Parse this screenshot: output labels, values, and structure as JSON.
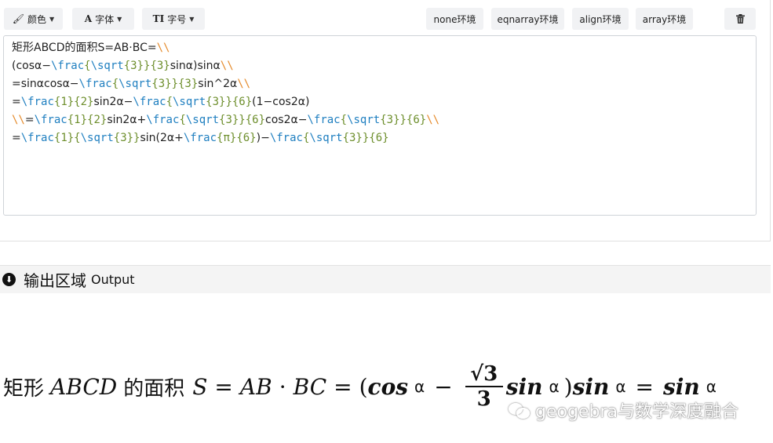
{
  "toolbar": {
    "color_label": "颜色",
    "font_label": "字体",
    "size_label": "字号",
    "env_buttons": [
      "none环境",
      "eqnarray环境",
      "align环境",
      "array环境"
    ],
    "trash_icon": "trash-icon"
  },
  "editor": {
    "lines": [
      [
        {
          "t": "txt",
          "v": "矩形ABCD的面积S=AB·BC="
        },
        {
          "t": "nl",
          "v": "\\\\"
        }
      ],
      [
        {
          "t": "txt",
          "v": "(cosα−"
        },
        {
          "t": "cmd",
          "v": "\\frac"
        },
        {
          "t": "arg",
          "v": "{"
        },
        {
          "t": "cmd",
          "v": "\\sqrt"
        },
        {
          "t": "arg",
          "v": "{3}}{3}"
        },
        {
          "t": "txt",
          "v": "sinα)sinα"
        },
        {
          "t": "nl",
          "v": "\\\\"
        }
      ],
      [
        {
          "t": "txt",
          "v": "=sinαcosα−"
        },
        {
          "t": "cmd",
          "v": "\\frac"
        },
        {
          "t": "arg",
          "v": "{"
        },
        {
          "t": "cmd",
          "v": "\\sqrt"
        },
        {
          "t": "arg",
          "v": "{3}}{3}"
        },
        {
          "t": "txt",
          "v": "sin^2α"
        },
        {
          "t": "nl",
          "v": "\\\\"
        }
      ],
      [
        {
          "t": "txt",
          "v": "="
        },
        {
          "t": "cmd",
          "v": "\\frac"
        },
        {
          "t": "arg",
          "v": "{1}{2}"
        },
        {
          "t": "txt",
          "v": "sin2α−"
        },
        {
          "t": "cmd",
          "v": "\\frac"
        },
        {
          "t": "arg",
          "v": "{"
        },
        {
          "t": "cmd",
          "v": "\\sqrt"
        },
        {
          "t": "arg",
          "v": "{3}}{6}"
        },
        {
          "t": "txt",
          "v": "(1−cos2α)"
        }
      ],
      [
        {
          "t": "nl",
          "v": "\\\\"
        },
        {
          "t": "txt",
          "v": "="
        },
        {
          "t": "cmd",
          "v": "\\frac"
        },
        {
          "t": "arg",
          "v": "{1}{2}"
        },
        {
          "t": "txt",
          "v": "sin2α+"
        },
        {
          "t": "cmd",
          "v": "\\frac"
        },
        {
          "t": "arg",
          "v": "{"
        },
        {
          "t": "cmd",
          "v": "\\sqrt"
        },
        {
          "t": "arg",
          "v": "{3}}{6}"
        },
        {
          "t": "txt",
          "v": "cos2α−"
        },
        {
          "t": "cmd",
          "v": "\\frac"
        },
        {
          "t": "arg",
          "v": "{"
        },
        {
          "t": "cmd",
          "v": "\\sqrt"
        },
        {
          "t": "arg",
          "v": "{3}}{6}"
        },
        {
          "t": "nl",
          "v": "\\\\"
        }
      ],
      [
        {
          "t": "txt",
          "v": "="
        },
        {
          "t": "cmd",
          "v": "\\frac"
        },
        {
          "t": "arg",
          "v": "{1}{"
        },
        {
          "t": "cmd",
          "v": "\\sqrt"
        },
        {
          "t": "arg",
          "v": "{3}}"
        },
        {
          "t": "txt",
          "v": "sin(2α+"
        },
        {
          "t": "cmd",
          "v": "\\frac"
        },
        {
          "t": "arg",
          "v": "{π}{6}"
        },
        {
          "t": "txt",
          "v": ")−"
        },
        {
          "t": "cmd",
          "v": "\\frac"
        },
        {
          "t": "arg",
          "v": "{"
        },
        {
          "t": "cmd",
          "v": "\\sqrt"
        },
        {
          "t": "arg",
          "v": "{3}}{6}"
        }
      ]
    ]
  },
  "output": {
    "title": "输出区域",
    "subtitle": "Output",
    "formula": {
      "cjk1": "矩形",
      "abcd": "ABCD",
      "cjk2": "的面积",
      "s": "S",
      "eq": "=",
      "ab": "AB",
      "dot": "·",
      "bc": "BC",
      "open": "(",
      "cos": "cos",
      "alpha": "α",
      "minus": "−",
      "frac_num": "√3",
      "frac_den": "3",
      "sin": "sin",
      "close": ")"
    }
  },
  "watermark": "geogebra与数学深度融合"
}
